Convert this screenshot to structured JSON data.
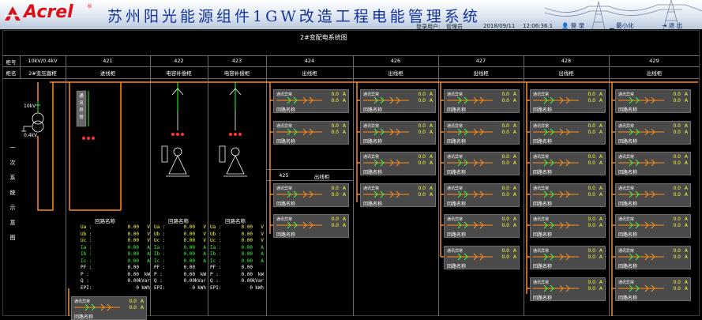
{
  "header": {
    "logo_text": "Acrel",
    "logo_mark": "®",
    "system_title": "苏州阳光能源组件1GW改造工程电能管理系统",
    "login_label": "登录用户:",
    "user": "管理员",
    "date": "2018/09/11",
    "time": "12:06:36.1",
    "buttons": [
      "登 录",
      "最小化",
      "退 出"
    ]
  },
  "page_title": "2#变配电系统图",
  "cabinet_row_label": "柜号",
  "cabinet_name_label": "柜名",
  "side_label": [
    "一",
    "次",
    "系",
    "统",
    "示",
    "意",
    "图"
  ],
  "columns": [
    {
      "no": "10kV/0.4kV",
      "name": "2#变压器柜"
    },
    {
      "no": "421",
      "name": "进线柜"
    },
    {
      "no": "422",
      "name": "电容补偿柜"
    },
    {
      "no": "423",
      "name": "电容补偿柜"
    },
    {
      "no": "424",
      "name": "出线柜"
    },
    {
      "no": "426",
      "name": "出线柜"
    },
    {
      "no": "427",
      "name": "出线柜"
    },
    {
      "no": "428",
      "name": "出线柜"
    },
    {
      "no": "429",
      "name": "出线柜"
    }
  ],
  "cab425": {
    "no": "425",
    "name": "出线柜"
  },
  "transformer": {
    "label_hv": "10kV",
    "label_lv": "0.4kV"
  },
  "breaker_tag": [
    "通",
    "讯",
    "异",
    "常"
  ],
  "panel": {
    "status": "通讯异常",
    "v": "0.0",
    "unit": "A",
    "name": "回路名称"
  },
  "measure_blocks": [
    {
      "title": "回路名称",
      "rows": [
        {
          "k": "Ua :",
          "v": "0.00",
          "u": "V"
        },
        {
          "k": "Ub :",
          "v": "0.00",
          "u": "V"
        },
        {
          "k": "Uc :",
          "v": "0.00",
          "u": "V"
        },
        {
          "k": "Ia :",
          "v": "0.00",
          "u": "A"
        },
        {
          "k": "Ib :",
          "v": "0.00",
          "u": "A"
        },
        {
          "k": "Ic :",
          "v": "0.00",
          "u": "A"
        },
        {
          "k": "PF :",
          "v": "0.00",
          "u": ""
        },
        {
          "k": "P  :",
          "v": "0.00",
          "u": "kW"
        },
        {
          "k": "Q  :",
          "v": "0.00",
          "u": "kVar"
        },
        {
          "k": "EPI:",
          "v": "0",
          "u": "kWh"
        }
      ]
    },
    {
      "title": "回路名称",
      "rows": [
        {
          "k": "Ua :",
          "v": "0.00",
          "u": "V"
        },
        {
          "k": "Ub :",
          "v": "0.00",
          "u": "V"
        },
        {
          "k": "Uc :",
          "v": "0.00",
          "u": "V"
        },
        {
          "k": "Ia :",
          "v": "0.00",
          "u": "A"
        },
        {
          "k": "Ib :",
          "v": "0.00",
          "u": "A"
        },
        {
          "k": "Ic :",
          "v": "0.00",
          "u": "A"
        },
        {
          "k": "PF :",
          "v": "0.00",
          "u": ""
        },
        {
          "k": "P  :",
          "v": "0.00",
          "u": "kW"
        },
        {
          "k": "Q  :",
          "v": "0.00",
          "u": "kVar"
        },
        {
          "k": "EPI:",
          "v": "0",
          "u": "kWh"
        }
      ]
    },
    {
      "title": "回路名称",
      "rows": [
        {
          "k": "Ua :",
          "v": "0.00",
          "u": "V"
        },
        {
          "k": "Ub :",
          "v": "0.00",
          "u": "V"
        },
        {
          "k": "Uc :",
          "v": "0.00",
          "u": "V"
        },
        {
          "k": "Ia :",
          "v": "0.00",
          "u": "A"
        },
        {
          "k": "Ib :",
          "v": "0.00",
          "u": "A"
        },
        {
          "k": "Ic :",
          "v": "0.00",
          "u": "A"
        },
        {
          "k": "PF :",
          "v": "0.00",
          "u": ""
        },
        {
          "k": "P  :",
          "v": "0.00",
          "u": "kW"
        },
        {
          "k": "Q  :",
          "v": "0.00",
          "u": "kVar"
        },
        {
          "k": "EPI:",
          "v": "0",
          "u": "kWh"
        }
      ]
    }
  ],
  "colors": {
    "busbar": "#ff8c1a",
    "breaker_on": "#33ff33",
    "breaker_off": "#ff3333",
    "value": "#ffff33",
    "panel_bg": "#4a4a4a"
  }
}
